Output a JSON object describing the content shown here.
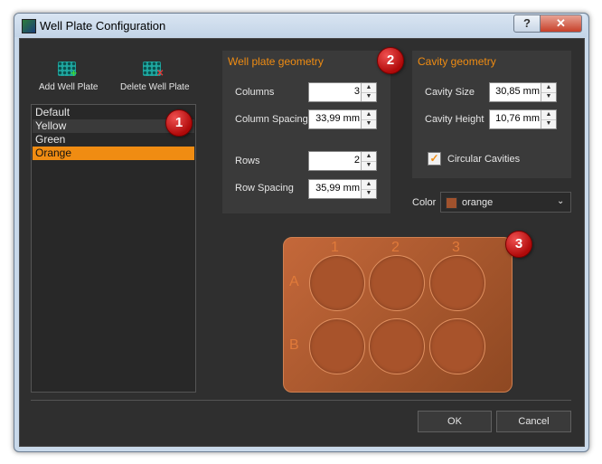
{
  "window": {
    "title": "Well Plate Configuration",
    "help": "?",
    "close": "✕"
  },
  "toolbar": {
    "add_label": "Add Well Plate",
    "delete_label": "Delete Well Plate"
  },
  "plates": {
    "items": [
      "Default",
      "Yellow",
      "Green",
      "Orange"
    ],
    "selected": "Orange"
  },
  "plate_geometry": {
    "title": "Well plate geometry",
    "columns_label": "Columns",
    "columns_value": "3",
    "column_spacing_label": "Column Spacing",
    "column_spacing_value": "33,99 mm",
    "rows_label": "Rows",
    "rows_value": "2",
    "row_spacing_label": "Row Spacing",
    "row_spacing_value": "35,99 mm"
  },
  "cavity_geometry": {
    "title": "Cavity geometry",
    "size_label": "Cavity Size",
    "size_value": "30,85 mm",
    "height_label": "Cavity Height",
    "height_value": "10,76 mm",
    "circular_label": "Circular Cavities",
    "circular_checked": true
  },
  "color": {
    "label": "Color",
    "value": "orange",
    "swatch": "#a0522d"
  },
  "preview": {
    "columns": [
      "1",
      "2",
      "3"
    ],
    "rows": [
      "A",
      "B"
    ]
  },
  "badges": [
    "1",
    "2",
    "3"
  ],
  "buttons": {
    "ok": "OK",
    "cancel": "Cancel"
  },
  "colors": {
    "accent": "#f08c12",
    "background": "#2f2f2f",
    "badge": "#c81414"
  }
}
